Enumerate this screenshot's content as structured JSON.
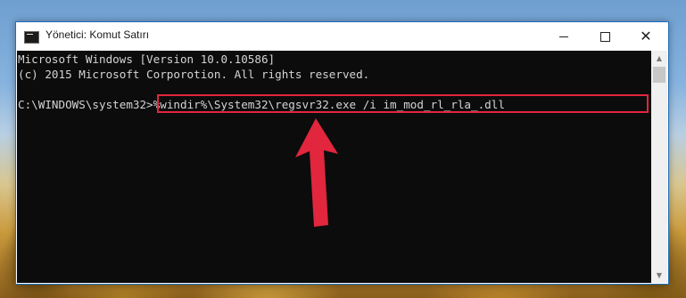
{
  "window": {
    "title": "Yönetici: Komut Satırı",
    "icon": "cmd-icon",
    "controls": {
      "minimize_icon": "minimize-icon",
      "maximize_icon": "maximize-icon",
      "close_glyph": "✕"
    }
  },
  "console": {
    "lines": [
      "Microsoft Windows [Version 10.0.10586]",
      "(c) 2015 Microsoft Corporotion. All rights reserved."
    ],
    "prompt": "C:\\WINDOWS\\system32>",
    "command": "%windir%\\System32\\regsvr32.exe /i im_mod_rl_rla_.dll"
  },
  "annotation": {
    "highlight_color": "#e1263d",
    "arrow_color": "#e1263d"
  },
  "scrollbar": {
    "up_glyph": "▲",
    "down_glyph": "▼"
  }
}
